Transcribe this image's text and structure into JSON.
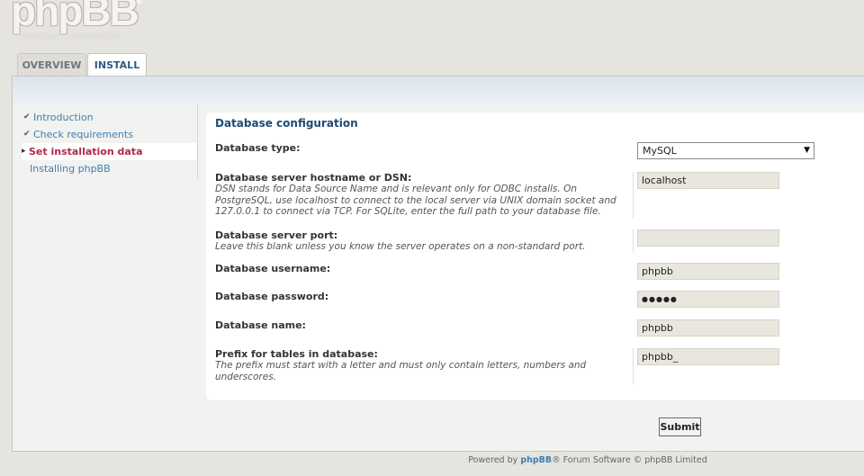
{
  "logo": {
    "wordmark": "phpBB",
    "registered": "®",
    "tagline_1": "creating",
    "tagline_2": "communities"
  },
  "tabs": [
    {
      "label": "OVERVIEW",
      "active": false
    },
    {
      "label": "INSTALL",
      "active": true
    }
  ],
  "menu": [
    {
      "label": "Introduction",
      "mark": "✔"
    },
    {
      "label": "Check requirements",
      "mark": "✔"
    },
    {
      "label": "Set installation data",
      "mark": "▸",
      "active": true
    },
    {
      "label": "Installing phpBB",
      "mark": ""
    }
  ],
  "form": {
    "legend": "Database configuration",
    "db_type": {
      "label": "Database type:",
      "value": "MySQL"
    },
    "db_host": {
      "label": "Database server hostname or DSN:",
      "desc": "DSN stands for Data Source Name and is relevant only for ODBC installs. On PostgreSQL, use localhost to connect to the local server via UNIX domain socket and 127.0.0.1 to connect via TCP. For SQLite, enter the full path to your database file.",
      "value": "localhost"
    },
    "db_port": {
      "label": "Database server port:",
      "desc": "Leave this blank unless you know the server operates on a non-standard port.",
      "value": ""
    },
    "db_user": {
      "label": "Database username:",
      "value": "phpbb"
    },
    "db_pass": {
      "label": "Database password:",
      "value": "●●●●●"
    },
    "db_name": {
      "label": "Database name:",
      "value": "phpbb"
    },
    "db_prefix": {
      "label": "Prefix for tables in database:",
      "desc": "The prefix must start with a letter and must only contain letters, numbers and underscores.",
      "value": "phpbb_"
    },
    "submit_label": "Submit"
  },
  "footer": {
    "prefix": "Powered by ",
    "brand": "phpBB",
    "suffix": "® Forum Software © phpBB Limited"
  },
  "colors": {
    "page_bg": "#e6e4de",
    "link": "#3f7fb0",
    "active_menu": "#b0284a",
    "legend": "#1f4a73"
  }
}
